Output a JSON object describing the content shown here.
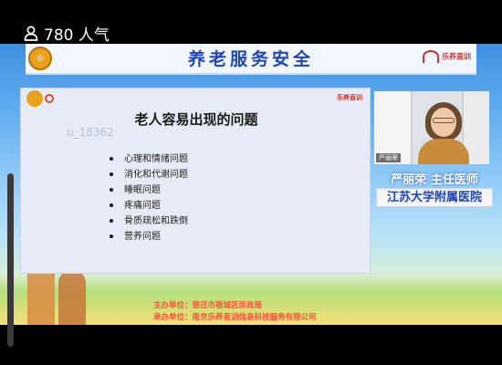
{
  "topbar": {
    "viewer_count": "780 人气",
    "viewer_icon": "person-icon"
  },
  "banner": {
    "title": "养老服务安全",
    "logo_right_text": "乐养直训"
  },
  "slide": {
    "logo_right_text": "乐养直训",
    "watermark": "u_18362",
    "title": "老人容易出现的问题",
    "items": [
      "心理和情绪问题",
      "消化和代谢问题",
      "睡眠问题",
      "疼痛问题",
      "骨质疏松和跌倒",
      "营养问题"
    ]
  },
  "camera": {
    "label": "严丽荣"
  },
  "speaker": {
    "name_title": "严丽荣 主任医师",
    "hospital": "江苏大学附属医院"
  },
  "footer": {
    "host": "主办单位：宿迁市宿城区民政局",
    "organizer": "承办单位：南京乐养直训信息科技服务有限公司"
  }
}
